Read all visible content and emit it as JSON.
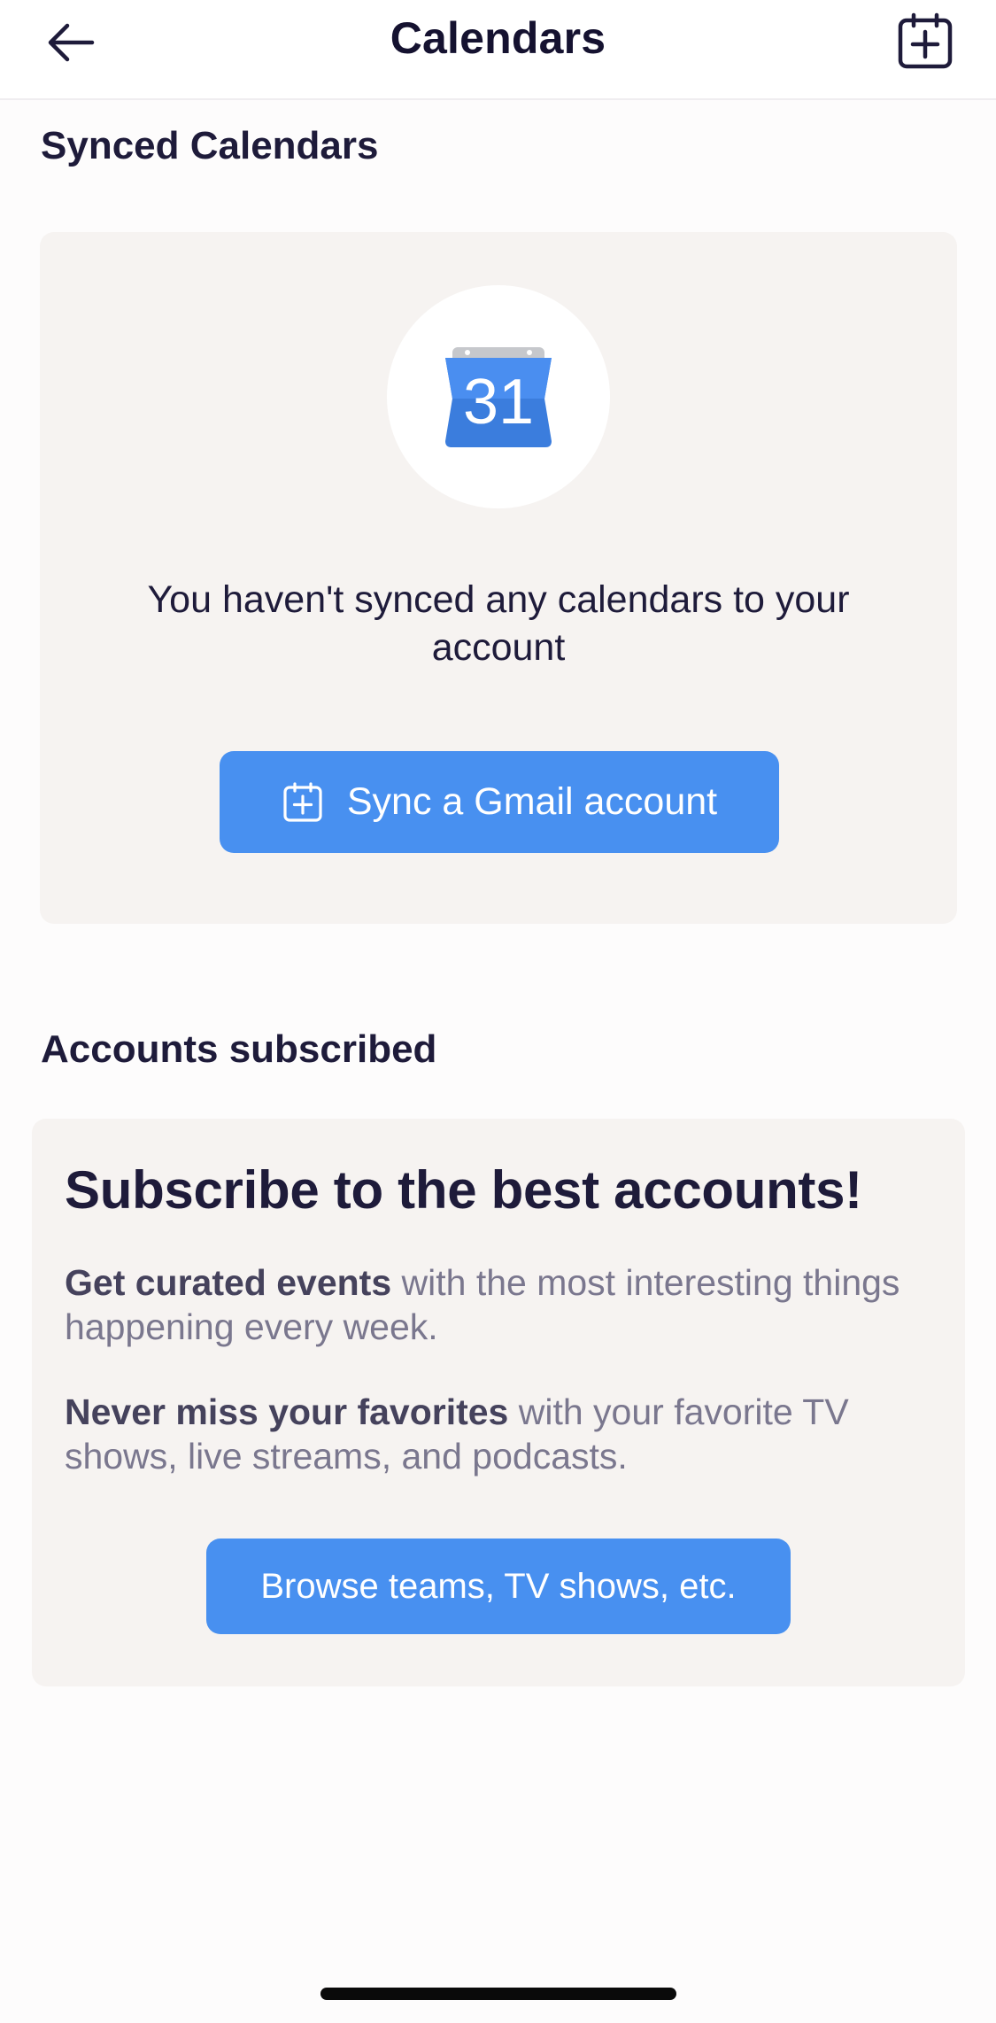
{
  "header": {
    "title": "Calendars",
    "back_icon": "arrow-left-icon",
    "add_icon": "calendar-plus-icon"
  },
  "synced": {
    "section_title": "Synced Calendars",
    "calendar_icon_number": "31",
    "empty_message": "You haven't synced any calendars to your account",
    "sync_button_label": "Sync a Gmail account",
    "sync_button_icon": "calendar-plus-icon"
  },
  "subscribed": {
    "section_title": "Accounts subscribed",
    "headline": "Subscribe to the best accounts!",
    "para1_bold": "Get curated events",
    "para1_rest": " with the most interesting things happening every week.",
    "para2_bold": "Never miss your favorites",
    "para2_rest": " with your favorite TV shows, live streams, and podcasts.",
    "browse_button_label": "Browse teams, TV shows, etc."
  },
  "colors": {
    "accent": "#4890f0",
    "card_bg": "#f6f3f1",
    "text_dark": "#1e1b3a",
    "text_muted": "#7a778e"
  }
}
